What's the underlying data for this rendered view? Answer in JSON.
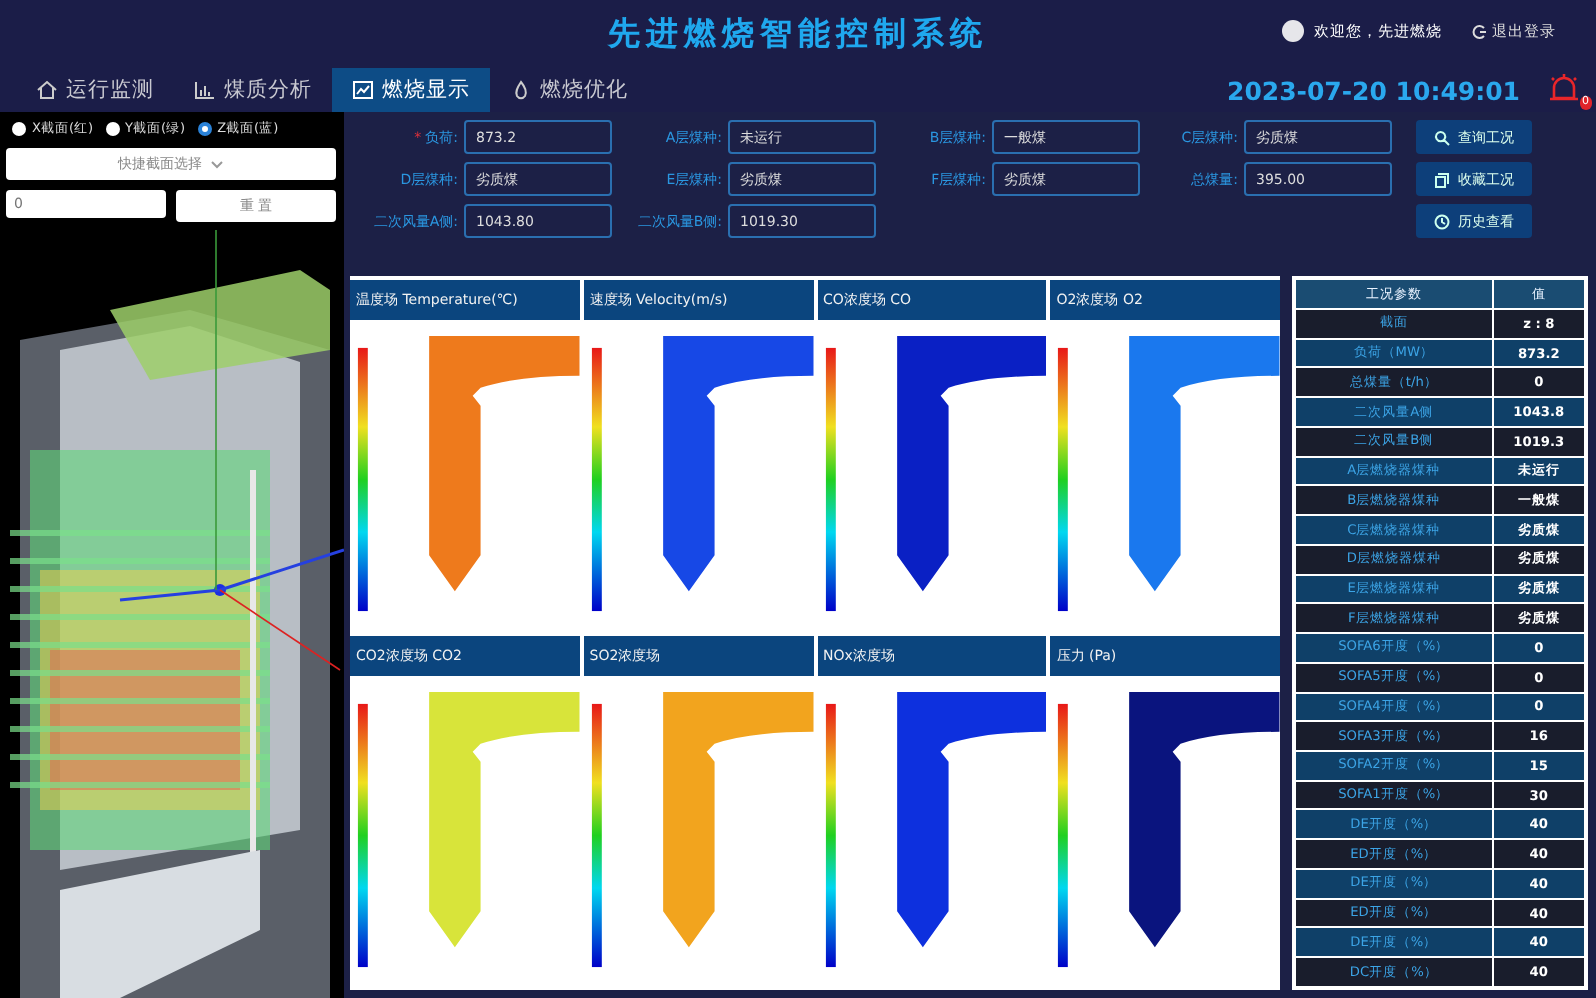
{
  "header": {
    "title": "先进燃烧智能控制系统",
    "greeting": "欢迎您，先进燃烧",
    "logout": "退出登录",
    "datetime": "2023-07-20 10:49:01",
    "alarm_badge": "0"
  },
  "nav": [
    {
      "label": "运行监测",
      "selected": false
    },
    {
      "label": "煤质分析",
      "selected": false
    },
    {
      "label": "燃烧显示",
      "selected": true
    },
    {
      "label": "燃烧优化",
      "selected": false
    }
  ],
  "left_panel": {
    "radios": [
      {
        "label": "X截面(红)",
        "selected": false
      },
      {
        "label": "Y截面(绿)",
        "selected": false
      },
      {
        "label": "Z截面(蓝)",
        "selected": true
      }
    ],
    "section_select": {
      "placeholder": "快捷截面选择"
    },
    "section_input": {
      "placeholder": "0"
    },
    "reset_button": "重 置"
  },
  "form": {
    "fields": [
      {
        "label": "负荷:",
        "required_mark": "*",
        "value": "873.2"
      },
      {
        "label": "A层煤种:",
        "value": "未运行"
      },
      {
        "label": "B层煤种:",
        "value": "一般煤"
      },
      {
        "label": "C层煤种:",
        "value": "劣质煤"
      },
      {
        "label": "D层煤种:",
        "value": "劣质煤"
      },
      {
        "label": "E层煤种:",
        "value": "劣质煤"
      },
      {
        "label": "F层煤种:",
        "value": "劣质煤"
      },
      {
        "label": "总煤量:",
        "value": "395.00"
      },
      {
        "label": "二次风量A侧:",
        "value": "1043.80"
      },
      {
        "label": "二次风量B侧:",
        "value": "1019.30"
      }
    ],
    "buttons": [
      "查询工况",
      "收藏工况",
      "历史查看"
    ]
  },
  "panels": [
    {
      "title": "温度场 Temperature(℃)",
      "color": "#ee7a1c"
    },
    {
      "title": "速度场 Velocity(m/s)",
      "color": "#1748e6"
    },
    {
      "title": "CO浓度场 CO",
      "color": "#0a20c4"
    },
    {
      "title": "O2浓度场 O2",
      "color": "#1a78ee"
    },
    {
      "title": "CO2浓度场 CO2",
      "color": "#d8e43a"
    },
    {
      "title": "SO2浓度场",
      "color": "#f2a41e"
    },
    {
      "title": "NOx浓度场",
      "color": "#0d30de"
    },
    {
      "title": "压力 (Pa)",
      "color": "#0a147e"
    }
  ],
  "table": {
    "columns": [
      "工况参数",
      "值"
    ],
    "rows": [
      [
        "截面",
        "z : 8"
      ],
      [
        "负荷（MW）",
        "873.2"
      ],
      [
        "总煤量（t/h）",
        "0"
      ],
      [
        "二次风量A侧",
        "1043.8"
      ],
      [
        "二次风量B侧",
        "1019.3"
      ],
      [
        "A层燃烧器煤种",
        "未运行"
      ],
      [
        "B层燃烧器煤种",
        "一般煤"
      ],
      [
        "C层燃烧器煤种",
        "劣质煤"
      ],
      [
        "D层燃烧器煤种",
        "劣质煤"
      ],
      [
        "E层燃烧器煤种",
        "劣质煤"
      ],
      [
        "F层燃烧器煤种",
        "劣质煤"
      ],
      [
        "SOFA6开度（%）",
        "0"
      ],
      [
        "SOFA5开度（%）",
        "0"
      ],
      [
        "SOFA4开度（%）",
        "0"
      ],
      [
        "SOFA3开度（%）",
        "16"
      ],
      [
        "SOFA2开度（%）",
        "15"
      ],
      [
        "SOFA1开度（%）",
        "30"
      ],
      [
        "DE开度（%）",
        "40"
      ],
      [
        "ED开度（%）",
        "40"
      ],
      [
        "DE开度（%）",
        "40"
      ],
      [
        "ED开度（%）",
        "40"
      ],
      [
        "DE开度（%）",
        "40"
      ],
      [
        "DC开度（%）",
        "40"
      ]
    ]
  }
}
